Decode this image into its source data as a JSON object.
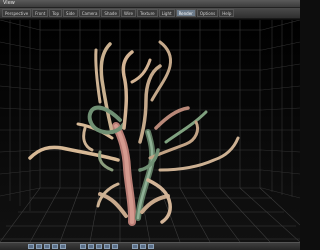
{
  "app": {
    "title": "View"
  },
  "toolbar": {
    "buttons": [
      {
        "label": "Perspective",
        "active": false
      },
      {
        "label": "Front",
        "active": false
      },
      {
        "label": "Top",
        "active": false
      },
      {
        "label": "Side",
        "active": false
      },
      {
        "label": "Camera",
        "active": false
      },
      {
        "label": "Shade",
        "active": false
      },
      {
        "label": "Wire",
        "active": false
      },
      {
        "label": "Texture",
        "active": false
      },
      {
        "label": "Light",
        "active": false
      },
      {
        "label": "Render",
        "active": true
      },
      {
        "label": "Options",
        "active": false
      },
      {
        "label": "Help",
        "active": false
      }
    ]
  },
  "statusbar": {
    "buttons": [
      "play",
      "stop",
      "rewind",
      "forward",
      "key",
      "loop",
      "select",
      "move",
      "rotate",
      "scale",
      "zoom",
      "pan",
      "frame"
    ]
  },
  "colors": {
    "grid": "#3b3b3b",
    "branch_light": "#d8b99a",
    "branch_green": "#6f8f73",
    "trunk_pink": "#c98a80"
  }
}
